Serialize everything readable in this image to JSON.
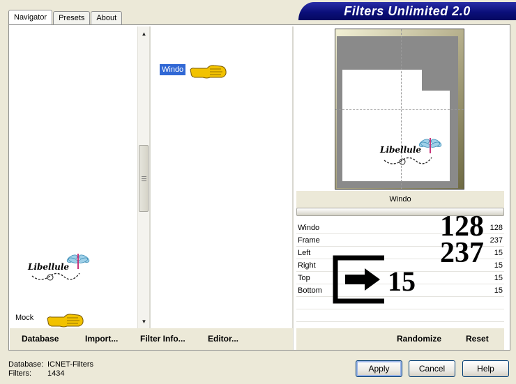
{
  "window": {
    "title": "Filters Unlimited 2.0"
  },
  "tabs": [
    {
      "label": "Navigator",
      "active": true
    },
    {
      "label": "Presets",
      "active": false
    },
    {
      "label": "About",
      "active": false
    }
  ],
  "left_list": {
    "visible_item": "Mock",
    "watermark": "Libellule"
  },
  "middle_list": {
    "selected_item": "Windo"
  },
  "toolbar": {
    "database_label": "Database",
    "import_label": "Import...",
    "filter_info_label": "Filter Info...",
    "editor_label": "Editor...",
    "randomize_label": "Randomize",
    "reset_label": "Reset"
  },
  "preview": {
    "filter_name": "Windo",
    "watermark": "Libellule"
  },
  "parameters": [
    {
      "label": "Windo",
      "value": "128"
    },
    {
      "label": "Frame",
      "value": "237"
    },
    {
      "label": "Left",
      "value": "15"
    },
    {
      "label": "Right",
      "value": "15"
    },
    {
      "label": "Top",
      "value": "15"
    },
    {
      "label": "Bottom",
      "value": "15"
    }
  ],
  "overlay": {
    "value_windo": "128",
    "value_frame": "237",
    "value_sides": "15"
  },
  "status": {
    "database_label": "Database:",
    "database_value": "ICNET-Filters",
    "filters_label": "Filters:",
    "filters_value": "1434"
  },
  "buttons": {
    "apply": "Apply",
    "cancel": "Cancel",
    "help": "Help"
  },
  "colors": {
    "banner": "#0b0f7a",
    "selection": "#3168d5",
    "pointer_hand": "#f2c200"
  }
}
